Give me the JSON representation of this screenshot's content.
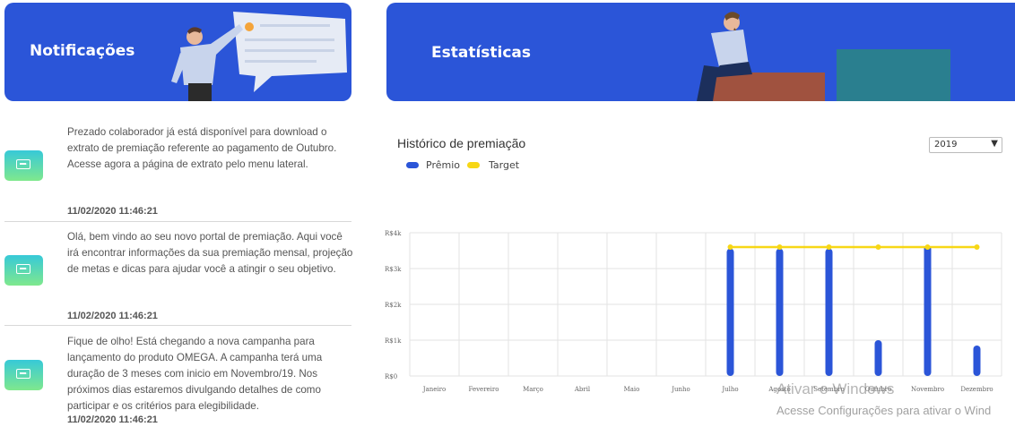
{
  "notifications_panel": {
    "title": "Notificações",
    "items": [
      {
        "text": "Prezado colaborador já está disponível para download o extrato de premiação referente ao pagamento de Outubro. Acesse agora a página de extrato pelo menu lateral.",
        "date": "11/02/2020 11:46:21"
      },
      {
        "text": "Olá, bem vindo ao seu novo portal de premiação. Aqui você irá encontrar informações da sua premiação mensal, projeção de metas e dicas para ajudar você a atingir o seu objetivo.",
        "date": "11/02/2020 11:46:21"
      },
      {
        "text": "Fique de olho! Está chegando a nova campanha para lançamento do produto OMEGA. A campanha terá uma duração de 3 meses com inicio em Novembro/19. Nos próximos dias estaremos divulgando detalhes de como participar e os critérios para elegibilidade.",
        "date": "11/02/2020 11:46:21"
      }
    ],
    "icon": "chat-bubble-icon"
  },
  "stats_panel": {
    "title": "Estatísticas",
    "chart_title": "Histórico de premiação",
    "year_select": {
      "selected": "2019"
    }
  },
  "colors": {
    "banner": "#2b55d8",
    "premio": "#2b55d8",
    "target": "#f7d716"
  },
  "chart_data": {
    "type": "bar",
    "title": "Histórico de premiação",
    "categories": [
      "Janeiro",
      "Fevereiro",
      "Março",
      "Abril",
      "Maio",
      "Junho",
      "Julho",
      "Agosto",
      "Setembro",
      "Outubro",
      "Novembro",
      "Dezembro"
    ],
    "series": [
      {
        "name": "Prêmio",
        "type": "bar",
        "values": [
          0,
          0,
          0,
          0,
          0,
          0,
          3560,
          3560,
          3560,
          1000,
          3650,
          850
        ]
      },
      {
        "name": "Target",
        "type": "line",
        "values": [
          null,
          null,
          null,
          null,
          null,
          null,
          3600,
          3600,
          3600,
          3600,
          3600,
          3600
        ]
      }
    ],
    "ylim": [
      0,
      4000
    ],
    "yticks": [
      0,
      1000,
      2000,
      3000,
      4000
    ],
    "ytick_labels": [
      "R$0",
      "R$1k",
      "R$2k",
      "R$3k",
      "R$4k"
    ],
    "legend": "top-left",
    "grid": true
  },
  "watermark": {
    "line1": "Ativar o Windows",
    "line2": "Acesse Configurações para ativar o Wind"
  }
}
